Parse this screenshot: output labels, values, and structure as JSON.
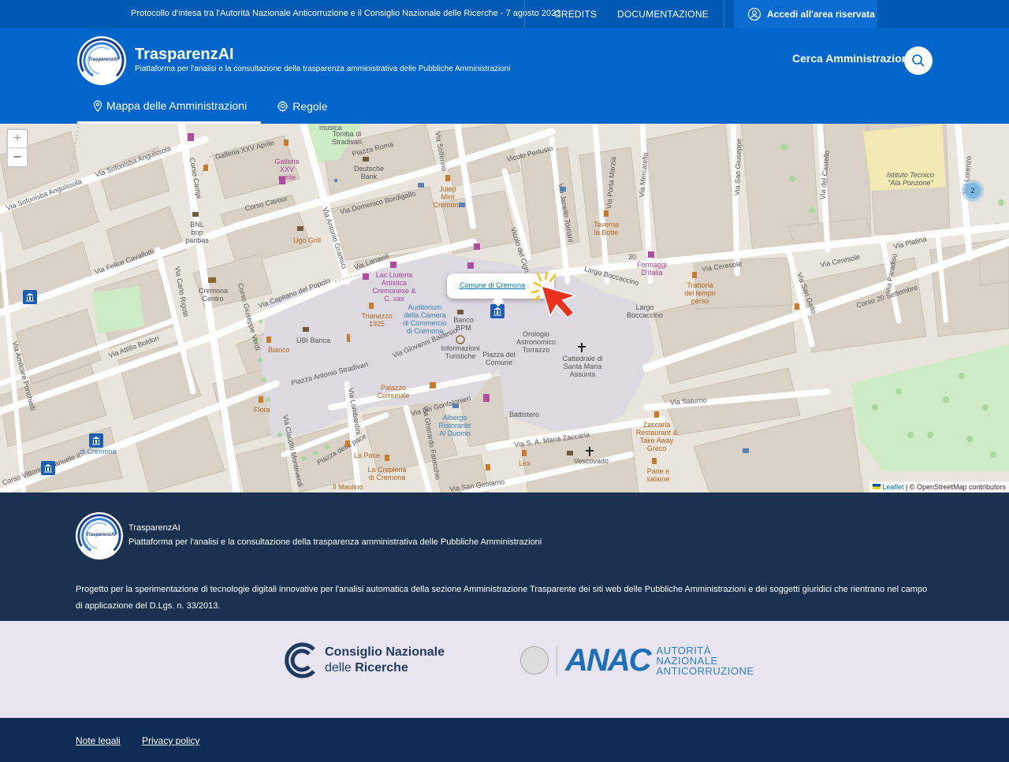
{
  "topbar": {
    "protocol": "Protocollo d'intesa tra l'Autorità Nazionale Anticorruzione e il Consiglio Nazionale delle Ricerche - 7 agosto 2023",
    "credits": "CREDITS",
    "documentation": "DOCUMENTAZIONE",
    "login": "Accedi all'area riservata"
  },
  "header": {
    "logo_text": "TrasparenzAI",
    "title": "TrasparenzAI",
    "tagline": "Piattaforma per l'analisi e la consultazione della trasparenza amministrativa delle Pubbliche Amministrazioni",
    "search_label": "Cerca Amministrazioni",
    "nav": [
      {
        "label": "Mappa delle Amministrazioni",
        "icon": "map-pin-icon",
        "active": true
      },
      {
        "label": "Regole",
        "icon": "gear-icon",
        "active": false
      }
    ]
  },
  "map": {
    "zoom_in": "+",
    "zoom_out": "–",
    "popup_link": "Comune di Cremona",
    "cluster_count": "2",
    "attribution_leaflet": "Leaflet",
    "attribution_rest": "| © OpenStreetMap contributors",
    "labels": {
      "galleria": "Galleria XXV Aprile",
      "piazza_roma": "Piazza Roma",
      "via_solferino": "Via Solferino",
      "vicolo_pertusio": "Vicolo Pertusio",
      "via_sofonisba": "Via Sofonisba Anguissola",
      "via_sofonisba2": "Via Sofonisba Anguissola",
      "corso_campi": "Corso Campi",
      "corso_cavour": "Corso Cavour",
      "via_bordigallo": "Via Domenico Bordigallo",
      "via_gramsci": "Via Antonio Gramsci",
      "via_cavallotti": "Via Felice Cavallotti",
      "via_rigotti": "Via Carlo Rigotti",
      "corso_verdi": "Corso Giuseppe Verdi",
      "via_capitano": "Via Capitano del Popolo",
      "via_lanaioli": "Via Lanaioli",
      "via_boldori": "Via Attilio Boldori",
      "via_baldesio": "Via Giovanni Baldesio",
      "piazza_stradivari": "Piazza Antonio Stradivari",
      "piazza_comune": "Piazza del Comune",
      "via_gonfalonieri": "Via dei Gonfalonieri",
      "via_lombardini": "Via Lombardini",
      "piazza_pace": "Piazza della pace",
      "via_monteverdi": "Via Claudio Monteverdi",
      "via_platina": "Via Platina",
      "via_amilcare": "Via Amilcare Ponchielli",
      "via_ceresole": "Via Ceresole",
      "via_ceresole2": "Via Ceresole",
      "corso_settembre": "Corso 20 Settembre",
      "largo_boccaccino": "Largo Boccaccino",
      "largo_boccaccino2": "Largo Boccaccino",
      "via_saturno": "Via Saturno",
      "via_zaccaria": "Via S. A. Maria Zaccaria",
      "via_san_girolamo": "Via San Girolamo",
      "via_vittorio": "Corso Vittorio Emanuele II",
      "via_mercatello": "Via Mercatello",
      "via_porta_marzia": "Via Porta Marzia",
      "via_san_giuseppe": "Via San Giuseppe",
      "via_castello": "Via del Castello",
      "via_lorenzo": "Via Lorenzo",
      "via_san_gallo": "Via San Gallo",
      "via_paradiso": "Via Paradiso",
      "via_fatecchio": "Via Gherardo Fatecchio",
      "vicolo_cign": "Vicolo del Cign",
      "via_janello": "Via Janello Torriani",
      "istituto": "Istituto Tecnico \"Ala Ponzone\"",
      "cattedrale": "Cattedrale di Santa Maria Assunta",
      "battistero": "Battistero",
      "vescovado": "Vescovado",
      "palazzo_comunale": "Palazzo Comunale",
      "torrazzo": "Orologio Astronomico Torrazzo",
      "info_turistiche": "Informazioni Turistiche",
      "auditorium": "Auditorium della Camera di Commercio di Cremona",
      "banco_bpm": "Banco BPM",
      "ubi": "UBI Banca",
      "bnl": "BNL bnp paribas",
      "deutsche": "Deutsche Bank",
      "cremona_centro": "Cremona Centro",
      "lac_liuteria": "Lac Liuteria Artistica Cremonese & C. sas",
      "trianezzo": "Trianezzo 1925",
      "albergo": "Albergo Ristorante Al Duomo",
      "la_pace": "La Pace",
      "la_crepieria": "La Crepieria di Cremona",
      "il_maulino": "Il Maulino",
      "flora": "Flora",
      "ugo_grill": "Ugo Grill",
      "bianco": "Bianco",
      "julep": "Julep Mint Cremona",
      "taverna": "Taverna la Botte",
      "formaggi": "Formaggi D'Italia",
      "trattoria": "Trattoria del tempo perso",
      "zaccaria_rest": "Zaccaria Restaurant & Take Away Greco",
      "pane": "Pane e salame",
      "lex": "Lex",
      "musica": "musica",
      "tomba": "Tomba di Stradivari",
      "xxv_aprile": "Galleria XXV aprile",
      "num30": "30",
      "comune_label": "di Cremona"
    }
  },
  "footer": {
    "logo_text": "TrasparenzAI",
    "name": "TrasparenzAI",
    "tagline": "Piattaforma per l'analisi e la consultazione della trasparenza amministrativa delle Pubbliche Amministrazioni",
    "description": "Progetto per la sperimentazione di tecnologie digitali innovative per l'analisi automatica della sezione Amministrazione Trasparente dei siti web delle Pubbliche Amministrazioni e dei soggetti giuridici che rientrano nel campo di applicazione del D.Lgs. n. 33/2013."
  },
  "partners": {
    "cnr_line1": "Consiglio Nazionale",
    "cnr_line2a": "delle ",
    "cnr_line2b": "Ricerche",
    "anac_word": "ANAC",
    "anac_line1": "AUTORITÀ",
    "anac_line2": "NAZIONALE",
    "anac_line3": "ANTICORRUZIONE"
  },
  "bottom": {
    "legal": "Note legali",
    "privacy": "Privacy policy"
  },
  "colors": {
    "topbar": "#0059b3",
    "header": "#0066cc",
    "footer": "#1a3150",
    "bottom": "#0f2d54",
    "partners_bg": "#e8e5f0"
  }
}
